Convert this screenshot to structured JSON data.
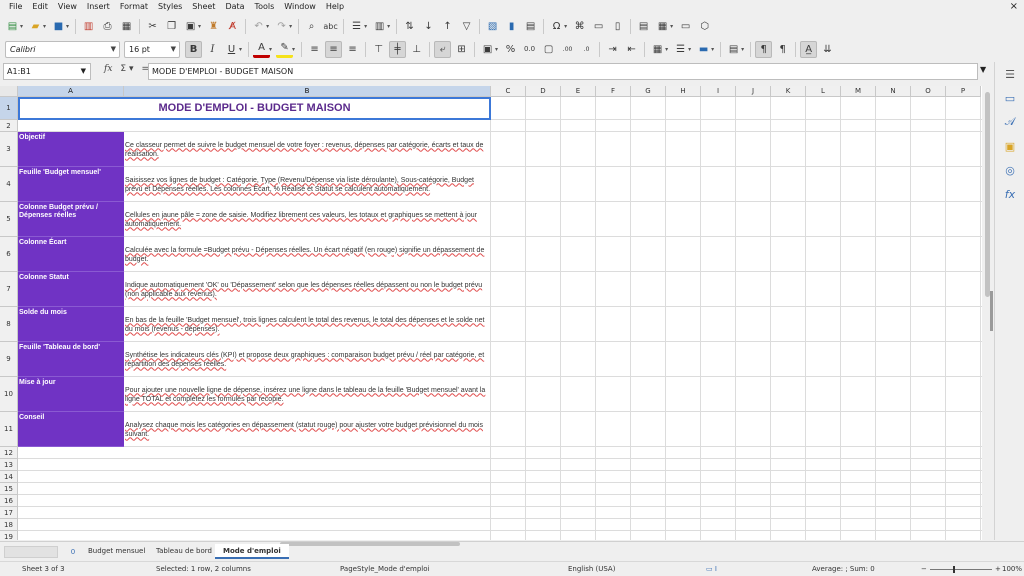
{
  "menubar": {
    "items": [
      "File",
      "Edit",
      "View",
      "Insert",
      "Format",
      "Styles",
      "Sheet",
      "Data",
      "Tools",
      "Window",
      "Help"
    ]
  },
  "toolbar": {
    "font_name": "Calibri",
    "font_size": "16 pt"
  },
  "formula_bar": {
    "name_box": "A1:B1",
    "content": "MODE D'EMPLOI - BUDGET MAISON"
  },
  "grid": {
    "columns": [
      "A",
      "B",
      "C",
      "D",
      "E",
      "F",
      "G",
      "H",
      "I",
      "J",
      "K",
      "L",
      "M",
      "N",
      "O",
      "P"
    ],
    "rows": [
      "1",
      "2",
      "3",
      "4",
      "5",
      "6",
      "7",
      "8",
      "9",
      "10",
      "11",
      "12",
      "13",
      "14",
      "15",
      "16",
      "17",
      "18",
      "19"
    ],
    "title": "MODE D'EMPLOI - BUDGET MAISON",
    "entries": [
      {
        "label": "Objectif",
        "text": "Ce classeur permet de suivre le budget mensuel de votre foyer : revenus, dépenses par catégorie, écarts et taux de réalisation."
      },
      {
        "label": "Feuille 'Budget mensuel'",
        "text": "Saisissez vos lignes de budget : Catégorie, Type (Revenu/Dépense via liste déroulante), Sous-catégorie, Budget prévu et Dépenses réelles. Les colonnes Écart, % Réalisé et Statut se calculent automatiquement."
      },
      {
        "label": "Colonne Budget prévu / Dépenses réelles",
        "text": "Cellules en jaune pâle = zone de saisie. Modifiez librement ces valeurs, les totaux et graphiques se mettent à jour automatiquement."
      },
      {
        "label": "Colonne Écart",
        "text": "Calculée avec la formule =Budget prévu - Dépenses réelles. Un écart négatif (en rouge) signifie un dépassement de budget."
      },
      {
        "label": "Colonne Statut",
        "text": "Indique automatiquement 'OK' ou 'Dépassement' selon que les dépenses réelles dépassent ou non le budget prévu (non applicable aux revenus)."
      },
      {
        "label": "Solde du mois",
        "text": "En bas de la feuille 'Budget mensuel', trois lignes calculent le total des revenus, le total des dépenses et le solde net du mois (revenus - dépenses)."
      },
      {
        "label": "Feuille 'Tableau de bord'",
        "text": "Synthétise les indicateurs clés (KPI) et propose deux graphiques : comparaison budget prévu / réel par catégorie, et répartition des dépenses réelles."
      },
      {
        "label": "Mise à jour",
        "text": "Pour ajouter une nouvelle ligne de dépense, insérez une ligne dans le tableau de la feuille 'Budget mensuel' avant la ligne TOTAL et complétez les formules par recopie."
      },
      {
        "label": "Conseil",
        "text": "Analysez chaque mois les catégories en dépassement (statut rouge) pour ajuster votre budget prévisionnel du mois suivant."
      }
    ]
  },
  "tabs": {
    "add_label": "0",
    "items": [
      "Budget mensuel",
      "Tableau de bord",
      "Mode d'emploi"
    ],
    "active": "Mode d'emploi"
  },
  "status": {
    "sheet": "Sheet 3 of 3",
    "selection": "Selected: 1 row, 2 columns",
    "page_style": "PageStyle_Mode d'emploi",
    "language": "English (USA)",
    "summary": "Average: ; Sum: 0",
    "zoom": "100%"
  }
}
